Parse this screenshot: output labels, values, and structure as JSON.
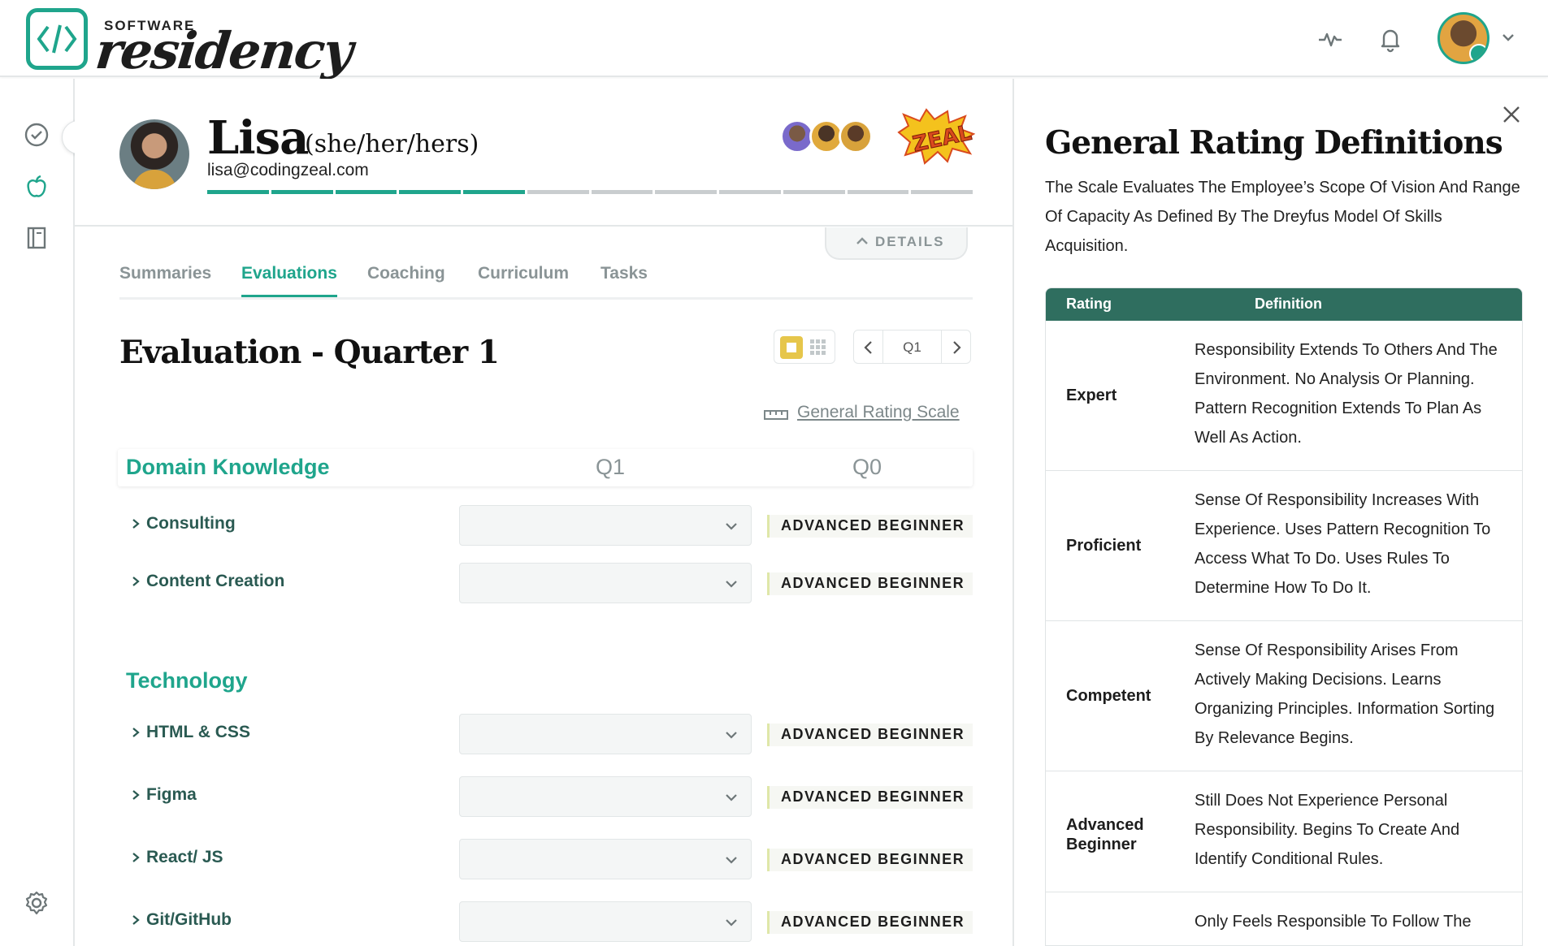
{
  "app": {
    "logo_small": "SOFTWARE",
    "logo_script": "residency"
  },
  "colors": {
    "accent": "#1fa58c",
    "table_header": "#2f6e5f",
    "muted": "#8a9496"
  },
  "header_icons": [
    "activity-icon",
    "bell-icon",
    "user-avatar",
    "chevron-down-icon"
  ],
  "rail_icons": [
    "check-circle-icon",
    "apple-icon",
    "book-icon",
    "gear-icon"
  ],
  "profile": {
    "name": "Lisa",
    "pronouns": "(she/her/hers)",
    "email": "lisa@codingzeal.com",
    "progress_completed_segments": 5,
    "progress_total_segments": 12,
    "badge_text": "ZEAL"
  },
  "details_label": "DETAILS",
  "tabs": [
    {
      "label": "Summaries",
      "active": false
    },
    {
      "label": "Evaluations",
      "active": true
    },
    {
      "label": "Coaching",
      "active": false
    },
    {
      "label": "Curriculum",
      "active": false
    },
    {
      "label": "Tasks",
      "active": false
    }
  ],
  "evaluation": {
    "title": "Evaluation - Quarter 1",
    "quarter": "Q1",
    "scale_link": "General Rating Scale",
    "columns": {
      "current": "Q1",
      "previous": "Q0"
    },
    "sections": [
      {
        "title": "Domain Knowledge",
        "rows": [
          {
            "label": "Consulting",
            "value": "",
            "prior": "ADVANCED BEGINNER"
          },
          {
            "label": "Content Creation",
            "value": "",
            "prior": "ADVANCED BEGINNER"
          }
        ]
      },
      {
        "title": "Technology",
        "rows": [
          {
            "label": "HTML & CSS",
            "value": "",
            "prior": "ADVANCED BEGINNER"
          },
          {
            "label": "Figma",
            "value": "",
            "prior": "ADVANCED BEGINNER"
          },
          {
            "label": "React/ JS",
            "value": "",
            "prior": "ADVANCED BEGINNER"
          },
          {
            "label": "Git/GitHub",
            "value": "",
            "prior": "ADVANCED BEGINNER"
          }
        ]
      }
    ]
  },
  "definitions_panel": {
    "title": "General Rating Definitions",
    "intro": "The Scale Evaluates The Employee’s Scope Of Vision And Range Of Capacity As Defined By The Dreyfus Model Of Skills Acquisition.",
    "header_rating": "Rating",
    "header_definition": "Definition",
    "rows": [
      {
        "rating": "Expert",
        "definition": "Responsibility Extends To Others And The Environment. No Analysis Or Planning. Pattern Recognition Extends To Plan As Well As Action."
      },
      {
        "rating": "Proficient",
        "definition": "Sense Of Responsibility Increases With Experience. Uses Pattern Recognition To Access What To Do. Uses Rules To Determine How To Do It."
      },
      {
        "rating": "Competent",
        "definition": "Sense Of Responsibility Arises From Actively Making Decisions. Learns Organizing Principles. Information Sorting By Relevance Begins."
      },
      {
        "rating": "Advanced Beginner",
        "definition": "Still Does Not Experience Personal Responsibility. Begins To Create And Identify Conditional Rules."
      },
      {
        "rating": "",
        "definition": "Only Feels Responsible To Follow The"
      }
    ]
  }
}
